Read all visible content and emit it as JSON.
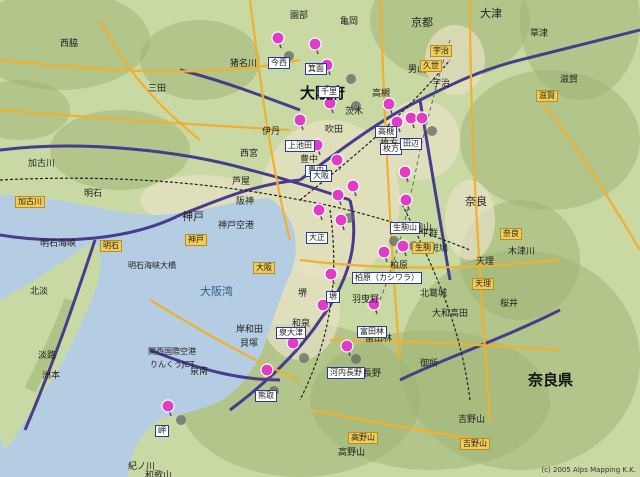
{
  "colors": {
    "land": "#c9d9a4",
    "mountain": "#9fb574",
    "urban": "#e8e1c6",
    "sea": "#b5cde2",
    "highway": "#4a3c8c",
    "road": "#f0b030",
    "rail": "#222222",
    "marker_pink": "#e03cc6",
    "marker_gray": "#666666"
  },
  "labels": {
    "osaka_fu": "大阪府",
    "nara_ken": "奈良県",
    "osaka_bay": "大阪湾",
    "akashi_strait": "明石海峡",
    "akashi_bridge": "明石海峡大橋",
    "kobe": "神戸",
    "kyoto": "京都",
    "otsu": "大津",
    "nara": "奈良",
    "awaji": "淡路",
    "sumoto": "洲本",
    "hokudan": "北淡",
    "kakogawa": "加古川",
    "akashi": "明石",
    "ashiya": "芦屋",
    "sakai": "堺",
    "izumi": "和泉",
    "kawachinagano": "河内長野",
    "tondabayashi": "富田林",
    "kisshu_bay": "紀ノ川",
    "wakayama": "和歌山",
    "kansai_airport": "関西国際空港",
    "rinku": "りんくうJCT",
    "yoshino": "吉野山",
    "koya": "高野山",
    "kizugawa": "木津川",
    "tenri": "天理",
    "sakurai": "桜井",
    "ikoma": "生駒山",
    "uji": "宇治",
    "kusatsu": "草津",
    "nishinomiya": "西宮",
    "itami": "伊丹",
    "toyonaka": "豊中",
    "suita": "吹田",
    "hirakata": "枚方",
    "takatsuki": "高槻",
    "ibaraki": "茨木",
    "nishiwaki": "西脇",
    "sanda": "三田",
    "kashiwara": "柏原",
    "habikino": "羽曳野",
    "kishiwada": "岸和田",
    "kaizuka": "貝塚",
    "sennan": "泉南",
    "kitakatsuragi": "北葛城",
    "yamatotakada": "大和高田",
    "gose": "御所",
    "ikaruga": "斑鳩",
    "heguri": "平群",
    "ino": "猪名川",
    "shiga": "滋賀",
    "otokoyama": "男山",
    "kameoka": "亀岡",
    "sonobe": "園部",
    "kobe_airport": "神戸空港",
    "hanshin": "阪神"
  },
  "stations": {
    "imanishi": "今西",
    "minoh": "箕面",
    "senri": "千里",
    "kamiikeda": "上池田",
    "toyonaka_st": "豊中",
    "hirakata_st": "枚方",
    "tanabe": "田辺",
    "takatsuki_st": "高槻",
    "higashiikoma": "生駒山",
    "kashiwara_st": "柏原（カシワラ）",
    "sakai_st": "堺",
    "tondabayashi_st": "富田林",
    "kawachinagano_st": "河内長野",
    "izumiotsu": "泉大津",
    "izumisano": "熊取",
    "misaki": "岬",
    "osaka_st": "大阪",
    "otani": "大正"
  },
  "yellow_labels": {
    "kobe_y": "神戸",
    "osaka_y": "大阪",
    "nara_y": "奈良",
    "ikoma_y": "生駒",
    "kuse": "久世",
    "yoshino_y": "吉野山",
    "koya_y": "高野山",
    "uji_y": "宇治",
    "tenri_y": "天理",
    "shiga_y": "滋賀",
    "kakogawa_y": "加古川",
    "akashi_y": "明石"
  },
  "copyright": "(c) 2005 Alps Mapping K.K."
}
